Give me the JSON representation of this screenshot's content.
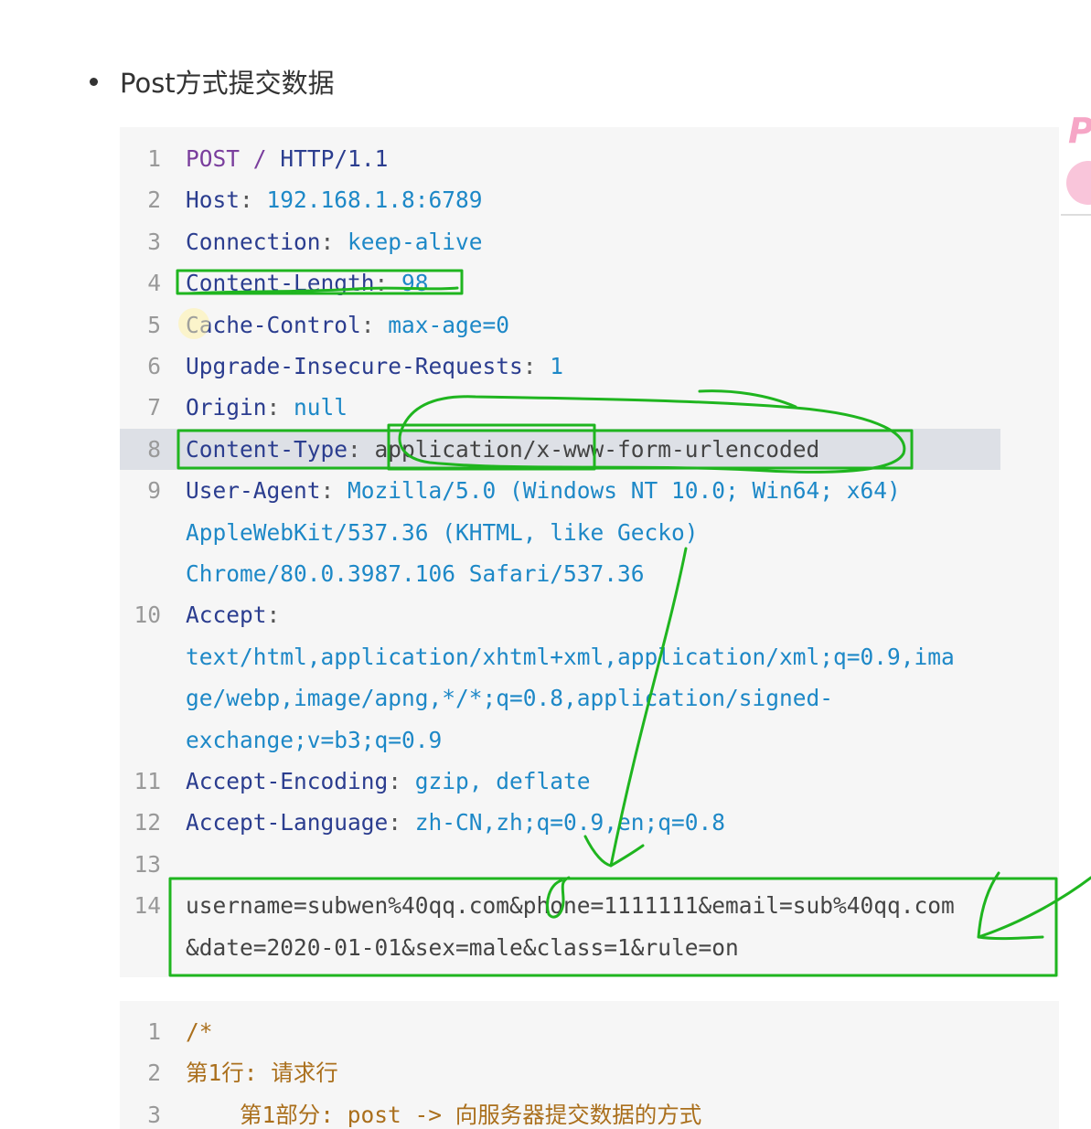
{
  "heading": "Post方式提交数据",
  "code_block_1": {
    "lines": [
      {
        "n": "1",
        "parts": [
          [
            "kw",
            "POST"
          ],
          [
            "punct",
            " "
          ],
          [
            "kw",
            "/"
          ],
          [
            "punct",
            " "
          ],
          [
            "hname",
            "HTTP/1.1"
          ]
        ]
      },
      {
        "n": "2",
        "parts": [
          [
            "hname",
            "Host"
          ],
          [
            "punct",
            ": "
          ],
          [
            "hval",
            "192.168.1.8:6789"
          ]
        ]
      },
      {
        "n": "3",
        "parts": [
          [
            "hname",
            "Connection"
          ],
          [
            "punct",
            ": "
          ],
          [
            "hval",
            "keep-alive"
          ]
        ]
      },
      {
        "n": "4",
        "parts": [
          [
            "hname",
            "Content-Length"
          ],
          [
            "punct",
            ": "
          ],
          [
            "hval",
            "98"
          ]
        ]
      },
      {
        "n": "5",
        "parts": [
          [
            "hname",
            "Cache-Control"
          ],
          [
            "punct",
            ": "
          ],
          [
            "hval",
            "max-age=0"
          ]
        ]
      },
      {
        "n": "6",
        "parts": [
          [
            "hname",
            "Upgrade-Insecure-Requests"
          ],
          [
            "punct",
            ": "
          ],
          [
            "hval",
            "1"
          ]
        ]
      },
      {
        "n": "7",
        "parts": [
          [
            "hname",
            "Origin"
          ],
          [
            "punct",
            ": "
          ],
          [
            "hval",
            "null"
          ]
        ]
      },
      {
        "n": "8",
        "parts": [
          [
            "hname",
            "Content-Type"
          ],
          [
            "punct",
            ": "
          ],
          [
            "body-text",
            "application/x-www-form-urlencoded"
          ]
        ],
        "highlight": true
      },
      {
        "n": "9",
        "parts": [
          [
            "hname",
            "User-Agent"
          ],
          [
            "punct",
            ": "
          ],
          [
            "hval",
            "Mozilla/5.0 (Windows NT 10.0; Win64; x64)"
          ]
        ]
      },
      {
        "n": "",
        "parts": [
          [
            "hval",
            "AppleWebKit/537.36 (KHTML, like Gecko)"
          ]
        ]
      },
      {
        "n": "",
        "parts": [
          [
            "hval",
            "Chrome/80.0.3987.106 Safari/537.36"
          ]
        ]
      },
      {
        "n": "10",
        "parts": [
          [
            "hname",
            "Accept"
          ],
          [
            "punct",
            ":"
          ]
        ]
      },
      {
        "n": "",
        "parts": [
          [
            "hval",
            "text/html,application/xhtml+xml,application/xml;q=0.9,ima"
          ]
        ]
      },
      {
        "n": "",
        "parts": [
          [
            "hval",
            "ge/webp,image/apng,*/*;q=0.8,application/signed-"
          ]
        ]
      },
      {
        "n": "",
        "parts": [
          [
            "hval",
            "exchange;v=b3;q=0.9"
          ]
        ]
      },
      {
        "n": "11",
        "parts": [
          [
            "hname",
            "Accept-Encoding"
          ],
          [
            "punct",
            ": "
          ],
          [
            "hval",
            "gzip, deflate"
          ]
        ]
      },
      {
        "n": "12",
        "parts": [
          [
            "hname",
            "Accept-Language"
          ],
          [
            "punct",
            ": "
          ],
          [
            "hval",
            "zh-CN,zh;q=0.9,en;q=0.8"
          ]
        ]
      },
      {
        "n": "13",
        "parts": []
      },
      {
        "n": "14",
        "parts": [
          [
            "body-text",
            "username=subwen%40qq.com&phone=1111111&email=sub%40qq.com"
          ]
        ]
      },
      {
        "n": "",
        "parts": [
          [
            "body-text",
            "&date=2020-01-01&sex=male&class=1&rule=on"
          ]
        ]
      }
    ]
  },
  "code_block_2": {
    "lines": [
      {
        "n": "1",
        "parts": [
          [
            "cmt-text",
            "/*"
          ]
        ]
      },
      {
        "n": "2",
        "parts": [
          [
            "cmt-text",
            "第1行: 请求行"
          ]
        ]
      },
      {
        "n": "3",
        "parts": [
          [
            "cmt-text",
            "    第1部分: post -> 向服务器提交数据的方式"
          ]
        ]
      }
    ]
  },
  "annotation_color": "#1fb51f",
  "side_logo_letter": "P"
}
